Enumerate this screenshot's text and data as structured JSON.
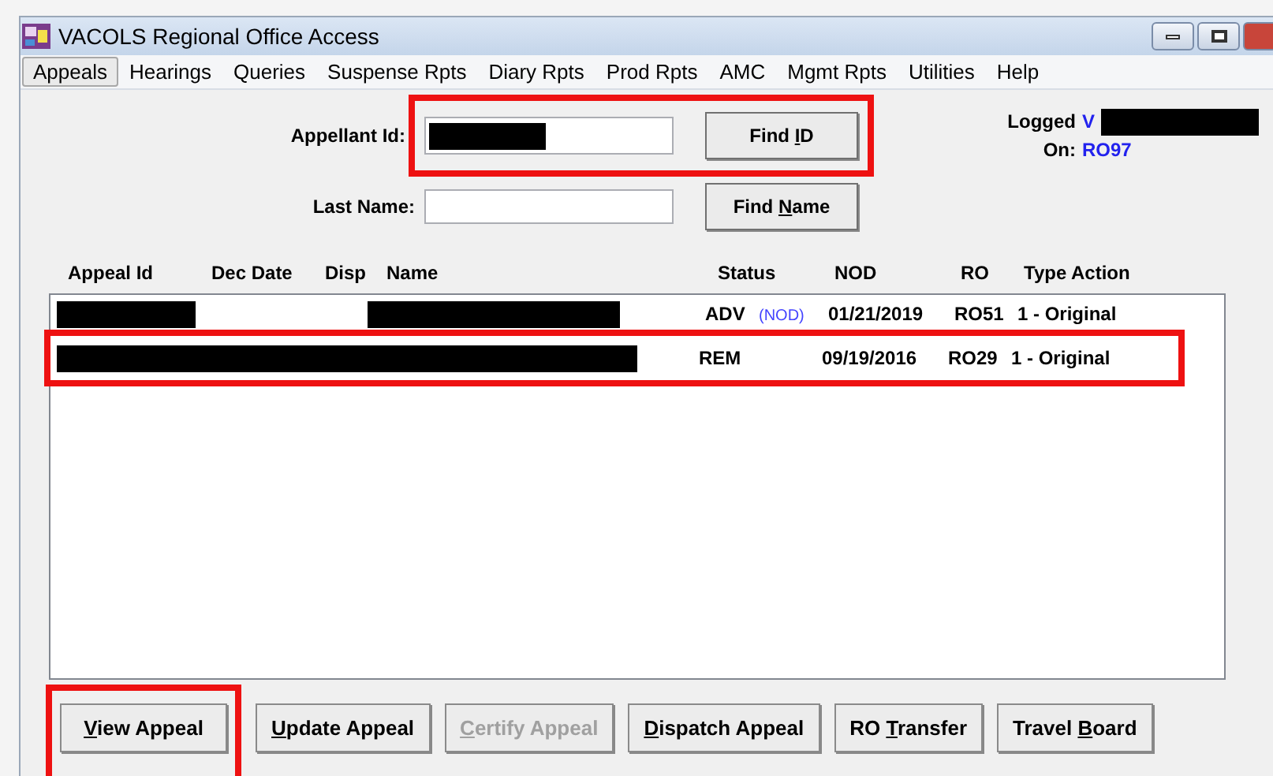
{
  "window": {
    "title": "VACOLS Regional Office Access"
  },
  "menu": [
    {
      "label": "Appeals",
      "selected": true
    },
    {
      "label": "Hearings",
      "selected": false
    },
    {
      "label": "Queries",
      "selected": false
    },
    {
      "label": "Suspense Rpts",
      "selected": false
    },
    {
      "label": "Diary Rpts",
      "selected": false
    },
    {
      "label": "Prod Rpts",
      "selected": false
    },
    {
      "label": "AMC",
      "selected": false
    },
    {
      "label": "Mgmt Rpts",
      "selected": false
    },
    {
      "label": "Utilities",
      "selected": false
    },
    {
      "label": "Help",
      "selected": false
    }
  ],
  "search": {
    "appellant_id_label": "Appellant Id:",
    "last_name_label": "Last Name:",
    "highlighted": true,
    "find_id": {
      "before": "Find ",
      "key": "I",
      "after": "D"
    },
    "find_name": {
      "before": "Find ",
      "key": "N",
      "after": "ame"
    }
  },
  "logged_on": {
    "logged_label": "Logged",
    "on_label": "On:",
    "user": "V",
    "office": "RO97"
  },
  "table": {
    "columns": [
      "Appeal Id",
      "Dec Date",
      "Disp",
      "Name",
      "Status",
      "NOD",
      "RO",
      "Type Action"
    ],
    "rows": [
      {
        "status": "ADV",
        "status_tag": "(NOD)",
        "nod": "01/21/2019",
        "ro": "RO51",
        "type_action": "1 - Original",
        "highlighted": false
      },
      {
        "status": "REM",
        "nod": "09/19/2016",
        "ro": "RO29",
        "type_action": "1 - Original",
        "highlighted": true
      }
    ]
  },
  "buttons": [
    {
      "key": "V",
      "after": "iew Appeal",
      "disabled": false,
      "highlighted": true
    },
    {
      "key": "U",
      "after": "pdate Appeal",
      "disabled": false,
      "highlighted": false
    },
    {
      "key": "C",
      "after": "ertify Appeal",
      "disabled": true,
      "highlighted": false
    },
    {
      "key": "D",
      "after": "ispatch Appeal",
      "disabled": false,
      "highlighted": false
    },
    {
      "before": "RO ",
      "key": "T",
      "after": "ransfer",
      "disabled": false,
      "highlighted": false
    },
    {
      "before": "Travel ",
      "key": "B",
      "after": "oard",
      "disabled": false,
      "highlighted": false
    }
  ]
}
